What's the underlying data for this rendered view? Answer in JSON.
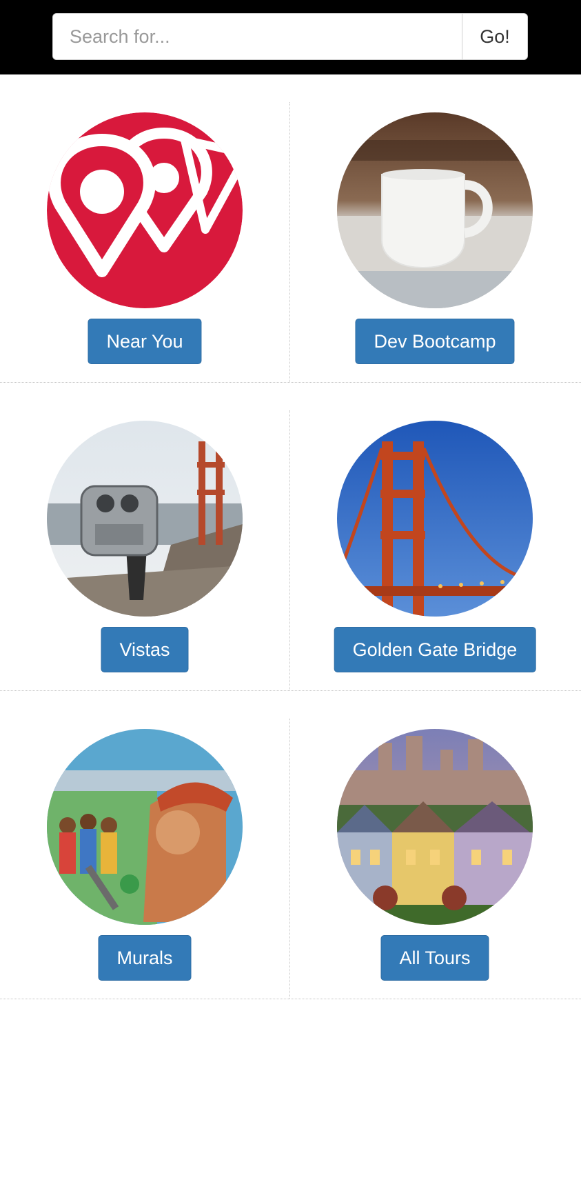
{
  "search": {
    "placeholder": "Search for...",
    "button_label": "Go!"
  },
  "categories": [
    {
      "label": "Near You",
      "image": "map-pins-logo"
    },
    {
      "label": "Dev Bootcamp",
      "image": "coffee-mug-photo"
    },
    {
      "label": "Vistas",
      "image": "viewer-binoculars-photo"
    },
    {
      "label": "Golden Gate Bridge",
      "image": "golden-gate-bridge-photo"
    },
    {
      "label": "Murals",
      "image": "street-mural-photo"
    },
    {
      "label": "All Tours",
      "image": "painted-ladies-houses-photo"
    }
  ],
  "colors": {
    "button_primary": "#337ab7",
    "logo_red": "#d8193c",
    "topbar": "#000000"
  }
}
